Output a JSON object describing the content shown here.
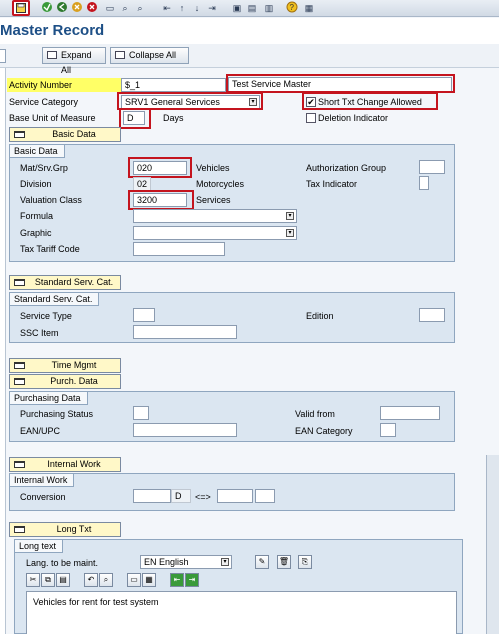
{
  "window": {
    "title": "Master Record"
  },
  "toolbar": {
    "icons": [
      "save-icon",
      "back-icon",
      "exit-icon",
      "cancel-icon",
      "print-icon",
      "find-icon",
      "first-page-icon",
      "prev-page-icon",
      "next-page-icon",
      "last-page-icon",
      "new-session-icon",
      "shortcut-icon",
      "help-icon",
      "layout-icon"
    ]
  },
  "app_toolbar": {
    "expand_all": "Expand All",
    "collapse_all": "Collapse All"
  },
  "header": {
    "activity_number_label": "Activity Number",
    "activity_number_value": "$_1",
    "short_text_value": "Test Service Master",
    "service_category_label": "Service Category",
    "service_category_value": "SRV1 General Services",
    "short_txt_change_label": "Short Txt Change Allowed",
    "short_txt_change_checked": "✔",
    "base_uom_label": "Base Unit of Measure",
    "base_uom_value": "D",
    "base_uom_text": "Days",
    "deletion_indicator_label": "Deletion Indicator"
  },
  "basic_data": {
    "button": "Basic Data",
    "group_title": "Basic Data",
    "mat_srv_grp_label": "Mat/Srv.Grp",
    "mat_srv_grp_value": "020",
    "mat_srv_grp_text": "Vehicles",
    "division_label": "Division",
    "division_value": "02",
    "division_text": "Motorcycles",
    "valuation_class_label": "Valuation Class",
    "valuation_class_value": "3200",
    "valuation_class_text": "Services",
    "formula_label": "Formula",
    "graphic_label": "Graphic",
    "tax_tariff_label": "Tax Tariff Code",
    "auth_group_label": "Authorization Group",
    "tax_indicator_label": "Tax Indicator"
  },
  "standard_serv": {
    "button": "Standard Serv. Cat.",
    "group_title": "Standard Serv. Cat.",
    "service_type_label": "Service Type",
    "ssc_item_label": "SSC Item",
    "edition_label": "Edition"
  },
  "time_mgmt": {
    "button": "Time Mgmt"
  },
  "purch_data": {
    "button": "Purch. Data",
    "group_title": "Purchasing Data",
    "purchasing_status_label": "Purchasing Status",
    "ean_upc_label": "EAN/UPC",
    "valid_from_label": "Valid from",
    "ean_category_label": "EAN Category"
  },
  "internal_work": {
    "button": "Internal Work",
    "group_title": "Internal Work",
    "conversion_label": "Conversion",
    "unit_value": "D",
    "arrow": "<=>"
  },
  "long_txt": {
    "button": "Long Txt",
    "group_title": "Long text",
    "lang_label": "Lang. to be maint.",
    "lang_value": "EN English",
    "text_value": "Vehicles for rent for test system"
  }
}
